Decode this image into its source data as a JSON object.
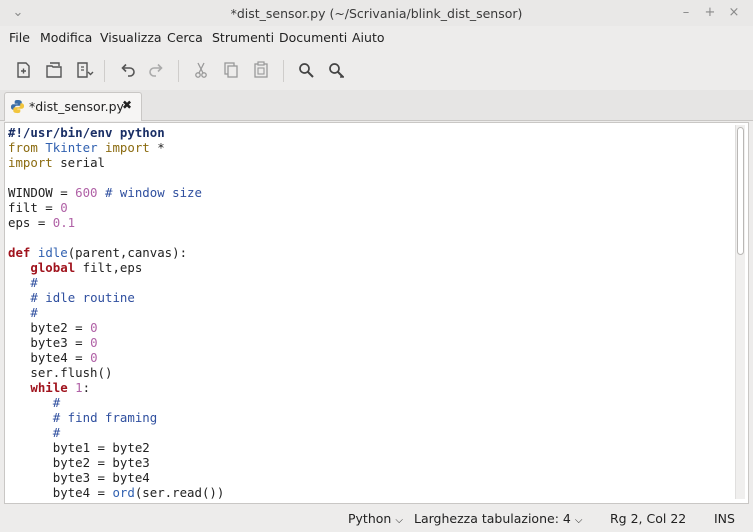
{
  "window": {
    "title": "*dist_sensor.py (~/Scrivania/blink_dist_sensor)",
    "controls": [
      "–",
      "+",
      "×"
    ]
  },
  "menu": [
    "File",
    "Modifica",
    "Visualizza",
    "Cerca",
    "Strumenti",
    "Documenti",
    "Aiuto"
  ],
  "toolbar": {
    "icons": [
      "new-document-icon",
      "open-document-icon",
      "save-document-icon",
      "undo-icon",
      "redo-icon",
      "cut-icon",
      "copy-icon",
      "paste-icon",
      "search-icon",
      "search-replace-icon"
    ]
  },
  "tab": {
    "label": "*dist_sensor.py",
    "close": "✖"
  },
  "code": [
    [
      [
        "sb",
        "#!/usr/bin/env python"
      ]
    ],
    [
      [
        "kw2",
        "from"
      ],
      [
        "",
        " "
      ],
      [
        "nm",
        "Tkinter"
      ],
      [
        "",
        " "
      ],
      [
        "kw2",
        "import"
      ],
      [
        "",
        " *"
      ]
    ],
    [
      [
        "kw2",
        "import"
      ],
      [
        "",
        " serial"
      ]
    ],
    [
      [
        "",
        ""
      ]
    ],
    [
      [
        "",
        "WINDOW = "
      ],
      [
        "num",
        "600"
      ],
      [
        "",
        " "
      ],
      [
        "cm",
        "# window size"
      ]
    ],
    [
      [
        "",
        "filt = "
      ],
      [
        "num",
        "0"
      ]
    ],
    [
      [
        "",
        "eps = "
      ],
      [
        "num",
        "0.1"
      ]
    ],
    [
      [
        "",
        ""
      ]
    ],
    [
      [
        "kw",
        "def"
      ],
      [
        "",
        " "
      ],
      [
        "nm",
        "idle"
      ],
      [
        "",
        "(parent,canvas):"
      ]
    ],
    [
      [
        "",
        "   "
      ],
      [
        "kw",
        "global"
      ],
      [
        "",
        " filt,eps"
      ]
    ],
    [
      [
        "",
        "   "
      ],
      [
        "cm",
        "#"
      ]
    ],
    [
      [
        "",
        "   "
      ],
      [
        "cm",
        "# idle routine"
      ]
    ],
    [
      [
        "",
        "   "
      ],
      [
        "cm",
        "#"
      ]
    ],
    [
      [
        "",
        "   byte2 = "
      ],
      [
        "num",
        "0"
      ]
    ],
    [
      [
        "",
        "   byte3 = "
      ],
      [
        "num",
        "0"
      ]
    ],
    [
      [
        "",
        "   byte4 = "
      ],
      [
        "num",
        "0"
      ]
    ],
    [
      [
        "",
        "   ser.flush()"
      ]
    ],
    [
      [
        "",
        "   "
      ],
      [
        "kw",
        "while"
      ],
      [
        "",
        " "
      ],
      [
        "num",
        "1"
      ],
      [
        "",
        ":"
      ]
    ],
    [
      [
        "",
        "      "
      ],
      [
        "cm",
        "#"
      ]
    ],
    [
      [
        "",
        "      "
      ],
      [
        "cm",
        "# find framing"
      ]
    ],
    [
      [
        "",
        "      "
      ],
      [
        "cm",
        "#"
      ]
    ],
    [
      [
        "",
        "      byte1 = byte2"
      ]
    ],
    [
      [
        "",
        "      byte2 = byte3"
      ]
    ],
    [
      [
        "",
        "      byte3 = byte4"
      ]
    ],
    [
      [
        "",
        "      byte4 = "
      ],
      [
        "nm",
        "ord"
      ],
      [
        "",
        "(ser.read())"
      ]
    ]
  ],
  "status": {
    "language": "Python",
    "tab_width_label": "Larghezza tabulazione:",
    "tab_width": "4",
    "position": "Rg 2, Col 22",
    "mode": "INS"
  }
}
